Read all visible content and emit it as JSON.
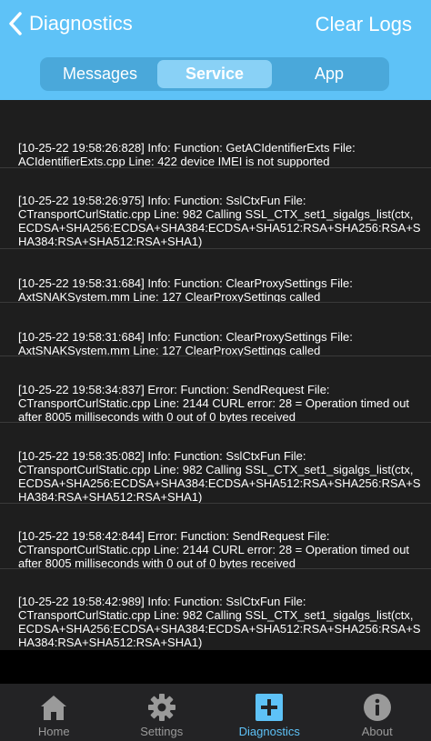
{
  "header": {
    "back_label": "Diagnostics",
    "action_label": "Clear Logs",
    "color": "#5ec2f7"
  },
  "segments": {
    "items": [
      "Messages",
      "Service",
      "App"
    ],
    "selected": "Service"
  },
  "log": {
    "entries": [
      "[10-25-22 19:58:26:828] Info: Function: GetACIdentifierExts File:\nACIdentifierExts.cpp Line: 422 device IMEI is not supported",
      "[10-25-22 19:58:26:975] Info: Function: SslCtxFun File:\nCTransportCurlStatic.cpp Line: 982 Calling SSL_CTX_set1_sigalgs_list(ctx,\nECDSA+SHA256:ECDSA+SHA384:ECDSA+SHA512:RSA+SHA256:RSA+S\nHA384:RSA+SHA512:RSA+SHA1)",
      "[10-25-22 19:58:31:684] Info: Function: ClearProxySettings File:\nAxtSNAKSystem.mm Line: 127 ClearProxySettings called",
      "[10-25-22 19:58:31:684] Info: Function: ClearProxySettings File:\nAxtSNAKSystem.mm Line: 127 ClearProxySettings called",
      "[10-25-22 19:58:34:837] Error: Function: SendRequest File:\nCTransportCurlStatic.cpp Line: 2144 CURL error: 28 = Operation timed out\nafter 8005 milliseconds with 0 out of 0 bytes received",
      "[10-25-22 19:58:35:082] Info: Function: SslCtxFun File:\nCTransportCurlStatic.cpp Line: 982 Calling SSL_CTX_set1_sigalgs_list(ctx,\nECDSA+SHA256:ECDSA+SHA384:ECDSA+SHA512:RSA+SHA256:RSA+S\nHA384:RSA+SHA512:RSA+SHA1)",
      "[10-25-22 19:58:42:844] Error: Function: SendRequest File:\nCTransportCurlStatic.cpp Line: 2144 CURL error: 28 = Operation timed out\nafter 8005 milliseconds with 0 out of 0 bytes received",
      "[10-25-22 19:58:42:989] Info: Function: SslCtxFun File:\nCTransportCurlStatic.cpp Line: 982 Calling SSL_CTX_set1_sigalgs_list(ctx,\nECDSA+SHA256:ECDSA+SHA384:ECDSA+SHA512:RSA+SHA256:RSA+S\nHA384:RSA+SHA512:RSA+SHA1)"
    ]
  },
  "tabbar": {
    "items": [
      {
        "label": "Home",
        "icon": "home-icon"
      },
      {
        "label": "Settings",
        "icon": "gear-icon"
      },
      {
        "label": "Diagnostics",
        "icon": "plus-square-icon"
      },
      {
        "label": "About",
        "icon": "info-circle-icon"
      }
    ],
    "selected": "Diagnostics",
    "active_color": "#5ec2f7",
    "inactive_color": "#9a9a9a"
  }
}
